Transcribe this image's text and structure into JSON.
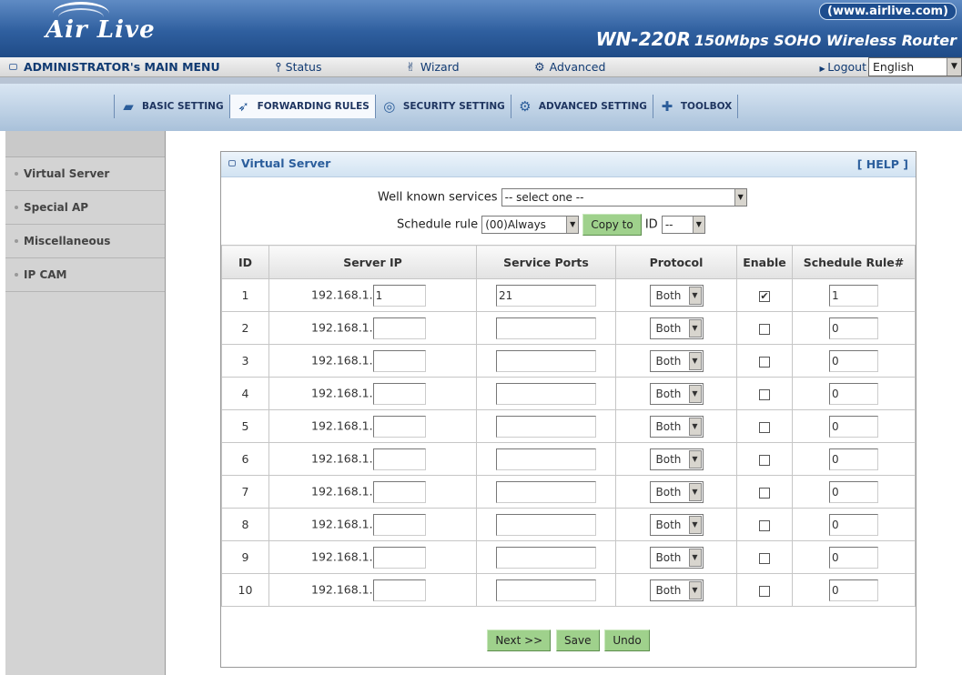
{
  "brand": {
    "logo": "Air Live",
    "url": "(www.airlive.com)",
    "model": "WN-220R",
    "description": "150Mbps SOHO Wireless Router"
  },
  "menubar": {
    "admin_label": "ADMINISTRATOR's MAIN MENU",
    "status": "Status",
    "wizard": "Wizard",
    "advanced": "Advanced",
    "logout": "Logout",
    "language": "English"
  },
  "tabs": [
    {
      "label": "BASIC SETTING",
      "icon": "folder-icon"
    },
    {
      "label": "FORWARDING RULES",
      "icon": "forward-icon"
    },
    {
      "label": "SECURITY SETTING",
      "icon": "shield-icon"
    },
    {
      "label": "ADVANCED SETTING",
      "icon": "advanced-icon"
    },
    {
      "label": "TOOLBOX",
      "icon": "toolbox-icon"
    }
  ],
  "active_tab": "FORWARDING RULES",
  "sidebar": {
    "items": [
      "Virtual Server",
      "Special AP",
      "Miscellaneous",
      "IP CAM"
    ]
  },
  "panel": {
    "title": "Virtual Server",
    "help": "[ HELP ]"
  },
  "controls": {
    "well_known_label": "Well known services",
    "well_known_value": "-- select one --",
    "schedule_label": "Schedule rule",
    "schedule_value": "(00)Always",
    "copy_button": "Copy to",
    "id_label": "ID",
    "id_value": "--"
  },
  "table": {
    "headers": [
      "ID",
      "Server IP",
      "Service Ports",
      "Protocol",
      "Enable",
      "Schedule Rule#"
    ],
    "ip_prefix": "192.168.1.",
    "rows": [
      {
        "id": "1",
        "ip": "1",
        "ports": "21",
        "protocol": "Both",
        "enabled": true,
        "rule": "1"
      },
      {
        "id": "2",
        "ip": "",
        "ports": "",
        "protocol": "Both",
        "enabled": false,
        "rule": "0"
      },
      {
        "id": "3",
        "ip": "",
        "ports": "",
        "protocol": "Both",
        "enabled": false,
        "rule": "0"
      },
      {
        "id": "4",
        "ip": "",
        "ports": "",
        "protocol": "Both",
        "enabled": false,
        "rule": "0"
      },
      {
        "id": "5",
        "ip": "",
        "ports": "",
        "protocol": "Both",
        "enabled": false,
        "rule": "0"
      },
      {
        "id": "6",
        "ip": "",
        "ports": "",
        "protocol": "Both",
        "enabled": false,
        "rule": "0"
      },
      {
        "id": "7",
        "ip": "",
        "ports": "",
        "protocol": "Both",
        "enabled": false,
        "rule": "0"
      },
      {
        "id": "8",
        "ip": "",
        "ports": "",
        "protocol": "Both",
        "enabled": false,
        "rule": "0"
      },
      {
        "id": "9",
        "ip": "",
        "ports": "",
        "protocol": "Both",
        "enabled": false,
        "rule": "0"
      },
      {
        "id": "10",
        "ip": "",
        "ports": "",
        "protocol": "Both",
        "enabled": false,
        "rule": "0"
      }
    ]
  },
  "buttons": {
    "next": "Next >>",
    "save": "Save",
    "undo": "Undo"
  }
}
